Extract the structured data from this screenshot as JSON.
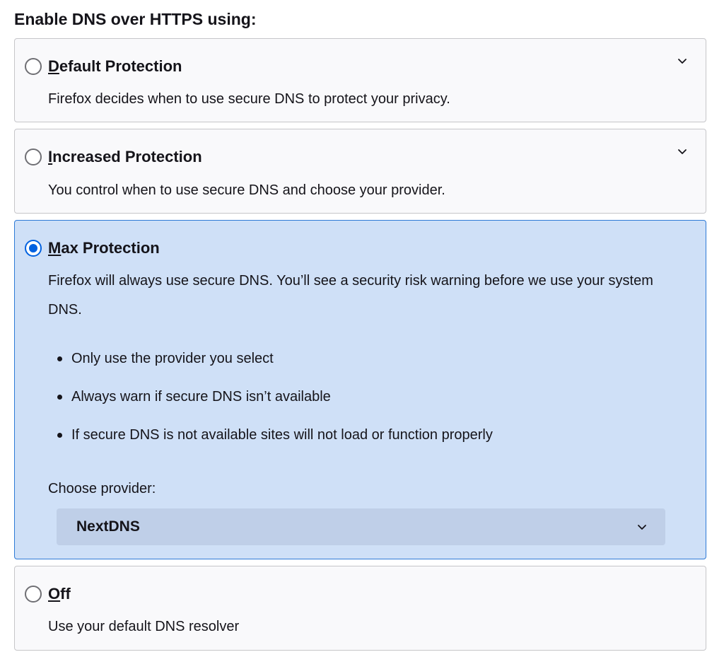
{
  "heading": "Enable DNS over HTTPS using:",
  "options": [
    {
      "access_key": "D",
      "title_rest": "efault Protection",
      "description": "Firefox decides when to use secure DNS to protect your privacy.",
      "selected": false
    },
    {
      "access_key": "I",
      "title_rest": "ncreased Protection",
      "description": "You control when to use secure DNS and choose your provider.",
      "selected": false
    },
    {
      "access_key": "M",
      "title_rest": "ax Protection",
      "description": "Firefox will always use secure DNS. You’ll see a security risk warning before we use your system DNS.",
      "selected": true,
      "bullets": [
        "Only use the provider you select",
        "Always warn if secure DNS isn’t available",
        "If secure DNS is not available sites will not load or function properly"
      ],
      "provider_label": "Choose provider:",
      "provider_value": "NextDNS"
    },
    {
      "access_key": "O",
      "title_rest": "ff",
      "description": "Use your default DNS resolver",
      "selected": false
    }
  ],
  "colors": {
    "accent": "#0061e0",
    "selected_background": "#cfe0f7",
    "selected_border": "#2e7ad6"
  },
  "icons": {
    "expand": "chevron-down-icon",
    "radio": "radio-button"
  }
}
